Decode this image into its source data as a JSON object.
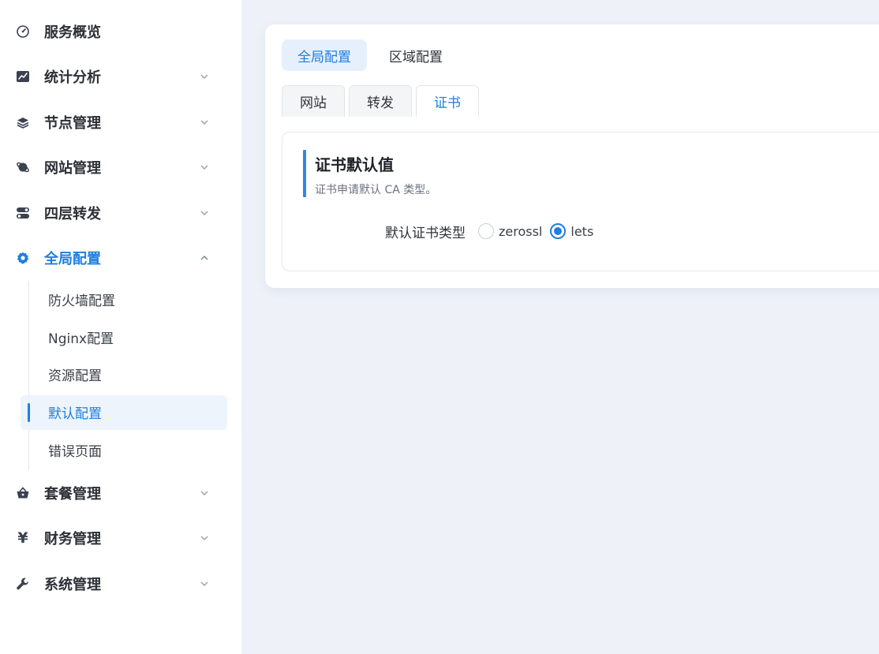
{
  "sidebar": {
    "items": [
      {
        "label": "服务概览",
        "icon": "dashboard-icon"
      },
      {
        "label": "统计分析",
        "icon": "chart-icon"
      },
      {
        "label": "节点管理",
        "icon": "layers-icon"
      },
      {
        "label": "网站管理",
        "icon": "planet-icon"
      },
      {
        "label": "四层转发",
        "icon": "toggle-icon"
      },
      {
        "label": "全局配置",
        "icon": "gear-icon"
      },
      {
        "label": "套餐管理",
        "icon": "basket-icon"
      },
      {
        "label": "财务管理",
        "icon": "yen-icon"
      },
      {
        "label": "系统管理",
        "icon": "wrench-icon"
      }
    ],
    "submenu": [
      {
        "label": "防火墙配置"
      },
      {
        "label": "Nginx配置"
      },
      {
        "label": "资源配置"
      },
      {
        "label": "默认配置"
      },
      {
        "label": "错误页面"
      }
    ],
    "yen_glyph": "¥"
  },
  "main": {
    "top_tabs": [
      {
        "label": "全局配置"
      },
      {
        "label": "区域配置"
      }
    ],
    "sub_tabs": [
      {
        "label": "网站"
      },
      {
        "label": "转发"
      },
      {
        "label": "证书"
      }
    ],
    "section": {
      "title": "证书默认值",
      "desc": "证书申请默认 CA 类型。"
    },
    "form": {
      "label": "默认证书类型",
      "options": [
        {
          "label": "zerossl"
        },
        {
          "label": "lets"
        }
      ],
      "selected": "lets"
    }
  },
  "colors": {
    "accent": "#1f7ee0",
    "sidebar_bg": "#ffffff",
    "page_bg": "#eef2f8"
  }
}
